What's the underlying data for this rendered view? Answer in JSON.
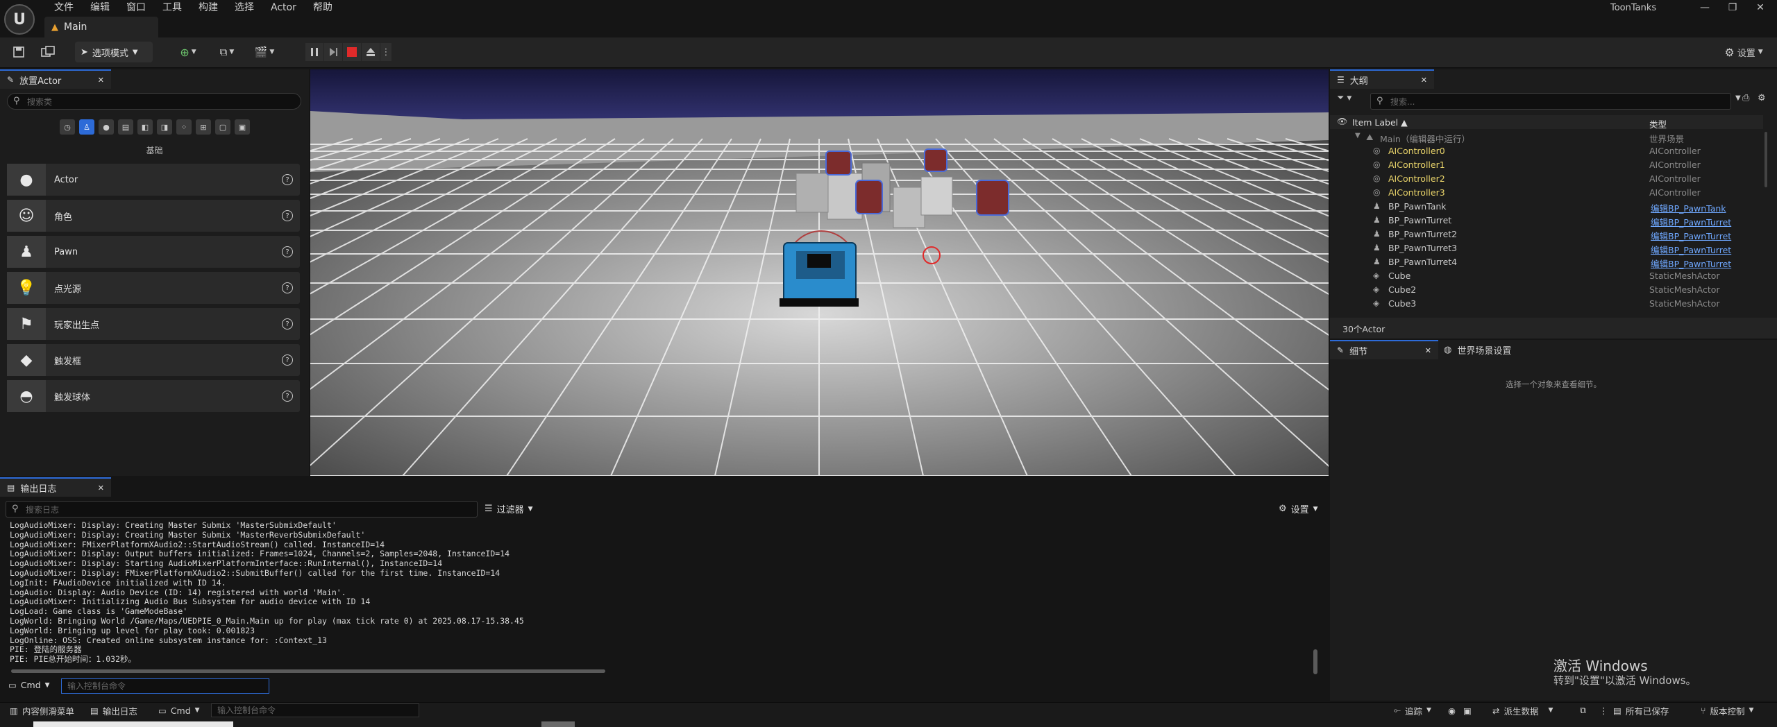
{
  "app": {
    "menu": [
      "文件",
      "编辑",
      "窗口",
      "工具",
      "构建",
      "选择",
      "Actor",
      "帮助"
    ],
    "level_tab": "Main",
    "project_name": "ToonTanks",
    "window_controls": [
      "—",
      "❐",
      "✕"
    ]
  },
  "toolbar": {
    "mode_label": "选项模式",
    "settings_label": "设置"
  },
  "place_actors": {
    "tab_label": "放置Actor",
    "search_placeholder": "搜索类",
    "category_label": "基础",
    "items": [
      {
        "label": "Actor",
        "icon": "sphere-icon"
      },
      {
        "label": "角色",
        "icon": "character-icon"
      },
      {
        "label": "Pawn",
        "icon": "pawn-icon"
      },
      {
        "label": "点光源",
        "icon": "point-light-icon"
      },
      {
        "label": "玩家出生点",
        "icon": "player-start-icon"
      },
      {
        "label": "触发框",
        "icon": "trigger-box-icon"
      },
      {
        "label": "触发球体",
        "icon": "trigger-sphere-icon"
      }
    ]
  },
  "outliner": {
    "tab_label": "大纲",
    "search_placeholder": "搜索...",
    "col_label": "Item Label ▲",
    "col_type": "类型",
    "root": {
      "label": "Main（编辑器中运行）",
      "type": "世界场景"
    },
    "rows": [
      {
        "label": "AIController0",
        "type": "AIController",
        "link": false,
        "highlight": true
      },
      {
        "label": "AIController1",
        "type": "AIController",
        "link": false,
        "highlight": true
      },
      {
        "label": "AIController2",
        "type": "AIController",
        "link": false,
        "highlight": true
      },
      {
        "label": "AIController3",
        "type": "AIController",
        "link": false,
        "highlight": true
      },
      {
        "label": "BP_PawnTank",
        "type": "编辑BP_PawnTank",
        "link": true,
        "highlight": false
      },
      {
        "label": "BP_PawnTurret",
        "type": "编辑BP_PawnTurret",
        "link": true,
        "highlight": false
      },
      {
        "label": "BP_PawnTurret2",
        "type": "编辑BP_PawnTurret",
        "link": true,
        "highlight": false
      },
      {
        "label": "BP_PawnTurret3",
        "type": "编辑BP_PawnTurret",
        "link": true,
        "highlight": false
      },
      {
        "label": "BP_PawnTurret4",
        "type": "编辑BP_PawnTurret",
        "link": true,
        "highlight": false
      },
      {
        "label": "Cube",
        "type": "StaticMeshActor",
        "link": false,
        "highlight": false
      },
      {
        "label": "Cube2",
        "type": "StaticMeshActor",
        "link": false,
        "highlight": false
      },
      {
        "label": "Cube3",
        "type": "StaticMeshActor",
        "link": false,
        "highlight": false
      }
    ],
    "count_label": "30个Actor"
  },
  "details": {
    "tab_label": "细节",
    "world_settings_tab": "世界场景设置",
    "empty_message": "选择一个对象来查看细节。"
  },
  "output_log": {
    "tab_label": "输出日志",
    "search_placeholder": "搜索日志",
    "filter_label": "过滤器",
    "settings_label": "设置",
    "lines": [
      "LogAudioMixer: Display: Creating Master Submix 'MasterSubmixDefault'",
      "LogAudioMixer: Display: Creating Master Submix 'MasterReverbSubmixDefault'",
      "LogAudioMixer: FMixerPlatformXAudio2::StartAudioStream() called. InstanceID=14",
      "LogAudioMixer: Display: Output buffers initialized: Frames=1024, Channels=2, Samples=2048, InstanceID=14",
      "LogAudioMixer: Display: Starting AudioMixerPlatformInterface::RunInternal(), InstanceID=14",
      "LogAudioMixer: Display: FMixerPlatformXAudio2::SubmitBuffer() called for the first time. InstanceID=14",
      "LogInit: FAudioDevice initialized with ID 14.",
      "LogAudio: Display: Audio Device (ID: 14) registered with world 'Main'.",
      "LogAudioMixer: Initializing Audio Bus Subsystem for audio device with ID 14",
      "LogLoad: Game class is 'GameModeBase'",
      "LogWorld: Bringing World /Game/Maps/UEDPIE_0_Main.Main up for play (max tick rate 0) at 2025.08.17-15.38.45",
      "LogWorld: Bringing up level for play took: 0.001823",
      "LogOnline: OSS: Created online subsystem instance for: :Context_13",
      "PIE: 登陆的服务器",
      "PIE: PIE总开始时间：1.032秒。"
    ],
    "cmd_label": "Cmd",
    "cmd_placeholder": "输入控制台命令"
  },
  "statusbar": {
    "content_drawer": "内容侧滑菜单",
    "output_log": "输出日志",
    "cmd_label": "Cmd",
    "cmd_placeholder": "输入控制台命令",
    "trace": "追踪",
    "derived_data": "派生数据",
    "all_saved": "所有已保存",
    "source_control": "版本控制"
  },
  "watermark": {
    "title": "激活 Windows",
    "subtitle": "转到\"设置\"以激活 Windows。"
  },
  "colors": {
    "accent_blue": "#2d6bd8",
    "stop_red": "#e02a2a",
    "controller_yellow": "#e8d36a",
    "link_blue": "#6fa8ff"
  }
}
